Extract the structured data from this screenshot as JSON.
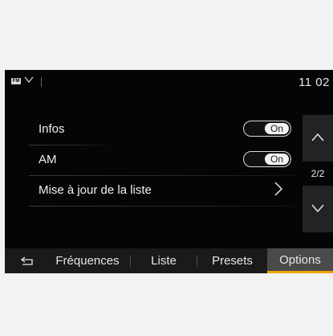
{
  "status": {
    "source_badge": "FM",
    "clock": "11 02"
  },
  "settings": [
    {
      "label": "Infos",
      "toggle": "On"
    },
    {
      "label": "AM",
      "toggle": "On"
    },
    {
      "label": "Mise à jour de la liste"
    }
  ],
  "pager": {
    "indicator": "2/2"
  },
  "tabs": {
    "frequences": "Fréquences",
    "liste": "Liste",
    "presets": "Presets",
    "options": "Options"
  },
  "colors": {
    "active_tab_underline": "#f0a500",
    "screen_background": "#050505"
  },
  "icons": [
    "back-arrow-icon",
    "chevron-up-icon",
    "chevron-down-icon",
    "chevron-right-icon"
  ]
}
